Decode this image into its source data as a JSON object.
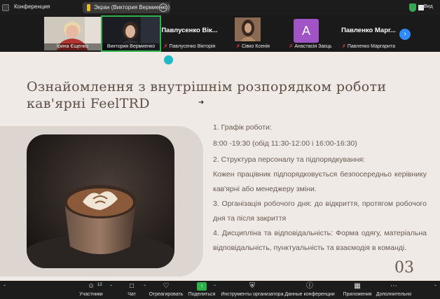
{
  "window": {
    "title": "Конференция"
  },
  "share_bar": {
    "label": "Экран (Виктория Вермиенко)",
    "more": "···"
  },
  "view": {
    "label": "Вид"
  },
  "participants": [
    {
      "name": "Ірина Єщенко"
    },
    {
      "name": "Виктория Вермиенко"
    },
    {
      "big_name": "Павлусенко Вік...",
      "name": "Павлусенко Вікторія"
    },
    {
      "name": "Сівко Ксенія"
    },
    {
      "avatar_letter": "A",
      "name": "Анастасія Заєць"
    },
    {
      "big_name": "Павленко Марг...",
      "name": "Павленко Маргарита"
    }
  ],
  "slide": {
    "title_line1": "Ознайомлення з внутрішнім розпорядком роботи",
    "title_line2": "кав'ярні FeelTRD",
    "items": [
      "1. Графік роботи:",
      "8:00 -19:30 (обід 11:30-12:00 і 16:00-16:30)",
      "2. Структура персоналу та підпорядкування:",
      "Кожен працівник підпорядковується безпосередньо керівнику кав'ярні або менеджеру зміни.",
      "3. Організація робочого дня: до відкриття, протягом робочого дня та після закриття",
      "4. Дисципліна та відповідальність: Форма одягу, матеріальна відповідальність, пунктуальність та взаємодія в команді."
    ],
    "page_number": "03"
  },
  "toolbar": {
    "participants_label": "Участники",
    "participants_count": "12",
    "chat_label": "Чат",
    "react_label": "Отреагировать",
    "share_label": "Поделиться",
    "host_tools_label": "Инструменты организатора",
    "info_label": "Данные конференции",
    "apps_label": "Приложения",
    "more_label": "Дополнительно"
  },
  "colors": {
    "accent": "#2d8cff",
    "share_green": "#2db14a",
    "slide_bg": "#efeae6",
    "slide_text": "#5e4e45",
    "avatar_purple": "#a154c6"
  }
}
